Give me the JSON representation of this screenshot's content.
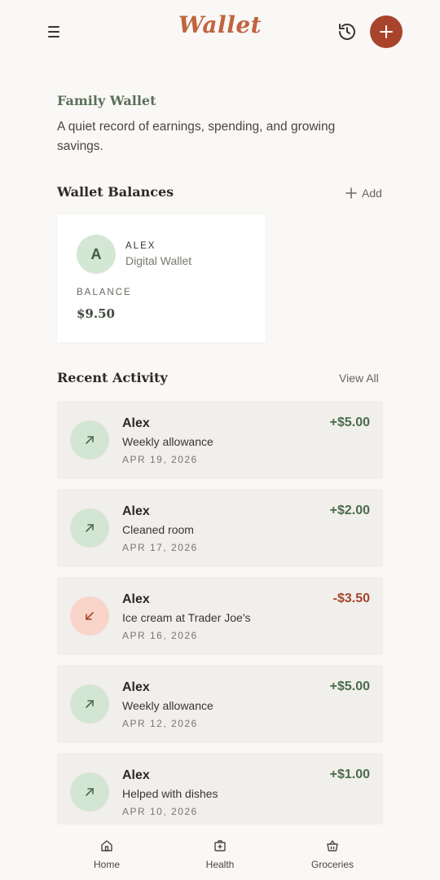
{
  "header": {
    "logo": "Wallet",
    "menu_icon": "menu-icon",
    "history_icon": "history-icon",
    "add_icon": "plus-icon",
    "accent": "#a8442c"
  },
  "intro": {
    "title": "Family Wallet",
    "description": "A quiet record of earnings, spending, and growing savings."
  },
  "balances": {
    "title": "Wallet Balances",
    "add_label": "Add",
    "cards": [
      {
        "initial": "A",
        "name": "ALEX",
        "type": "Digital Wallet",
        "balance_label": "BALANCE",
        "balance": "$9.50"
      }
    ]
  },
  "activity": {
    "title": "Recent Activity",
    "view_all": "View All",
    "items": [
      {
        "name": "Alex",
        "description": "Weekly allowance",
        "date": "APR 19, 2026",
        "amount": "+$5.00",
        "kind": "income"
      },
      {
        "name": "Alex",
        "description": "Cleaned room",
        "date": "APR 17, 2026",
        "amount": "+$2.00",
        "kind": "income"
      },
      {
        "name": "Alex",
        "description": "Ice cream at Trader Joe's",
        "date": "APR 16, 2026",
        "amount": "-$3.50",
        "kind": "expense"
      },
      {
        "name": "Alex",
        "description": "Weekly allowance",
        "date": "APR 12, 2026",
        "amount": "+$5.00",
        "kind": "income"
      },
      {
        "name": "Alex",
        "description": "Helped with dishes",
        "date": "APR 10, 2026",
        "amount": "+$1.00",
        "kind": "income"
      }
    ]
  },
  "nav": {
    "items": [
      {
        "label": "Home",
        "icon": "home-icon"
      },
      {
        "label": "Health",
        "icon": "health-icon"
      },
      {
        "label": "Groceries",
        "icon": "basket-icon"
      }
    ]
  },
  "colors": {
    "income": "#4a6b4a",
    "expense": "#a8442c",
    "income_bg": "#d3e5d3",
    "expense_bg": "#f8d5c8"
  }
}
